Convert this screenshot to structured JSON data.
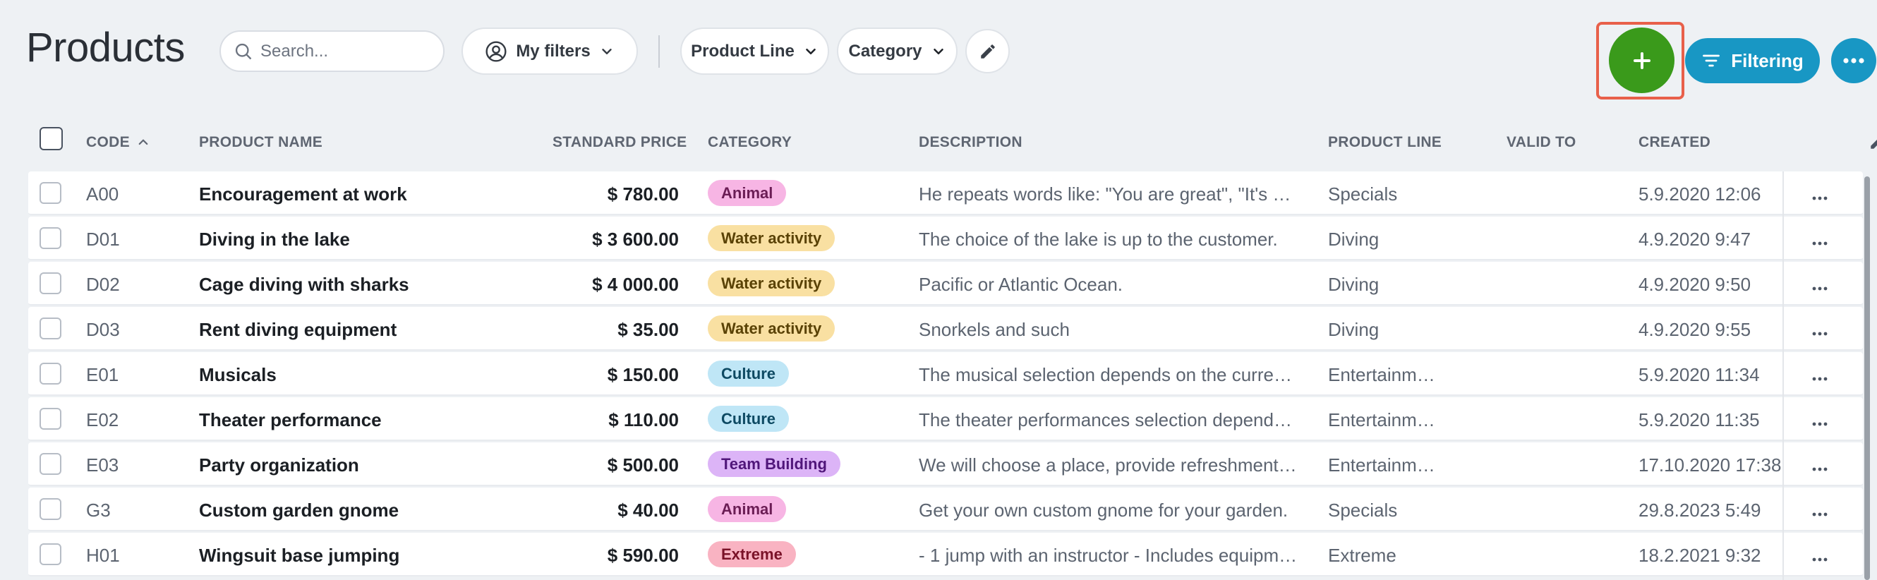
{
  "header": {
    "title": "Products",
    "search_placeholder": "Search...",
    "my_filters_label": "My filters",
    "product_line_label": "Product Line",
    "category_label": "Category",
    "filtering_label": "Filtering"
  },
  "icons": {
    "search": "search-icon",
    "user": "user-circle-icon",
    "chevron": "chevron-down-icon",
    "edit": "pencil-icon",
    "add": "plus-icon",
    "filter": "filter-lines-icon",
    "more": "more-horizontal-icon",
    "sort": "sort-ascending-icon"
  },
  "colors": {
    "add_button": "#3a9a1b",
    "highlight": "#e8604a",
    "primary": "#1897c4"
  },
  "table": {
    "columns": {
      "code": "CODE",
      "product_name": "PRODUCT NAME",
      "standard_price": "STANDARD PRICE",
      "category": "CATEGORY",
      "description": "DESCRIPTION",
      "product_line": "PRODUCT LINE",
      "valid_to": "VALID TO",
      "created": "CREATED"
    },
    "category_styles": {
      "Animal": {
        "bg": "#f7b5e4",
        "fg": "#6b1d55"
      },
      "Water activity": {
        "bg": "#f9e0a2",
        "fg": "#5a4205"
      },
      "Culture": {
        "bg": "#bfe6f6",
        "fg": "#0e4a63"
      },
      "Team Building": {
        "bg": "#dcb4f7",
        "fg": "#50167a"
      },
      "Extreme": {
        "bg": "#f9b3c2",
        "fg": "#7a1228"
      }
    },
    "rows": [
      {
        "code": "A00",
        "name": "Encouragement at work",
        "price": "$ 780.00",
        "category": "Animal",
        "description": "He repeats words like: \"You are great\", \"It's go…",
        "product_line": "Specials",
        "valid_to": "",
        "created": "5.9.2020 12:06"
      },
      {
        "code": "D01",
        "name": "Diving in the lake",
        "price": "$ 3 600.00",
        "category": "Water activity",
        "description": "The choice of the lake is up to the customer.",
        "product_line": "Diving",
        "valid_to": "",
        "created": "4.9.2020 9:47"
      },
      {
        "code": "D02",
        "name": "Cage diving with sharks",
        "price": "$ 4 000.00",
        "category": "Water activity",
        "description": "Pacific or Atlantic Ocean.",
        "product_line": "Diving",
        "valid_to": "",
        "created": "4.9.2020 9:50"
      },
      {
        "code": "D03",
        "name": "Rent diving equipment",
        "price": "$ 35.00",
        "category": "Water activity",
        "description": "Snorkels and such",
        "product_line": "Diving",
        "valid_to": "",
        "created": "4.9.2020 9:55"
      },
      {
        "code": "E01",
        "name": "Musicals",
        "price": "$ 150.00",
        "category": "Culture",
        "description": "The musical selection depends on the curren…",
        "product_line": "Entertainme…",
        "valid_to": "",
        "created": "5.9.2020 11:34"
      },
      {
        "code": "E02",
        "name": "Theater performance",
        "price": "$ 110.00",
        "category": "Culture",
        "description": "The theater performances selection depends…",
        "product_line": "Entertainme…",
        "valid_to": "",
        "created": "5.9.2020 11:35"
      },
      {
        "code": "E03",
        "name": "Party organization",
        "price": "$ 500.00",
        "category": "Team Building",
        "description": "We will choose a place, provide refreshments…",
        "product_line": "Entertainme…",
        "valid_to": "",
        "created": "17.10.2020 17:38"
      },
      {
        "code": "G3",
        "name": "Custom garden gnome",
        "price": "$ 40.00",
        "category": "Animal",
        "description": "Get your own custom gnome for your garden.",
        "product_line": "Specials",
        "valid_to": "",
        "created": "29.8.2023 5:49"
      },
      {
        "code": "H01",
        "name": "Wingsuit base jumping",
        "price": "$ 590.00",
        "category": "Extreme",
        "description": "- 1 jump with an instructor - Includes equipm…",
        "product_line": "Extreme",
        "valid_to": "",
        "created": "18.2.2021 9:32"
      }
    ]
  }
}
